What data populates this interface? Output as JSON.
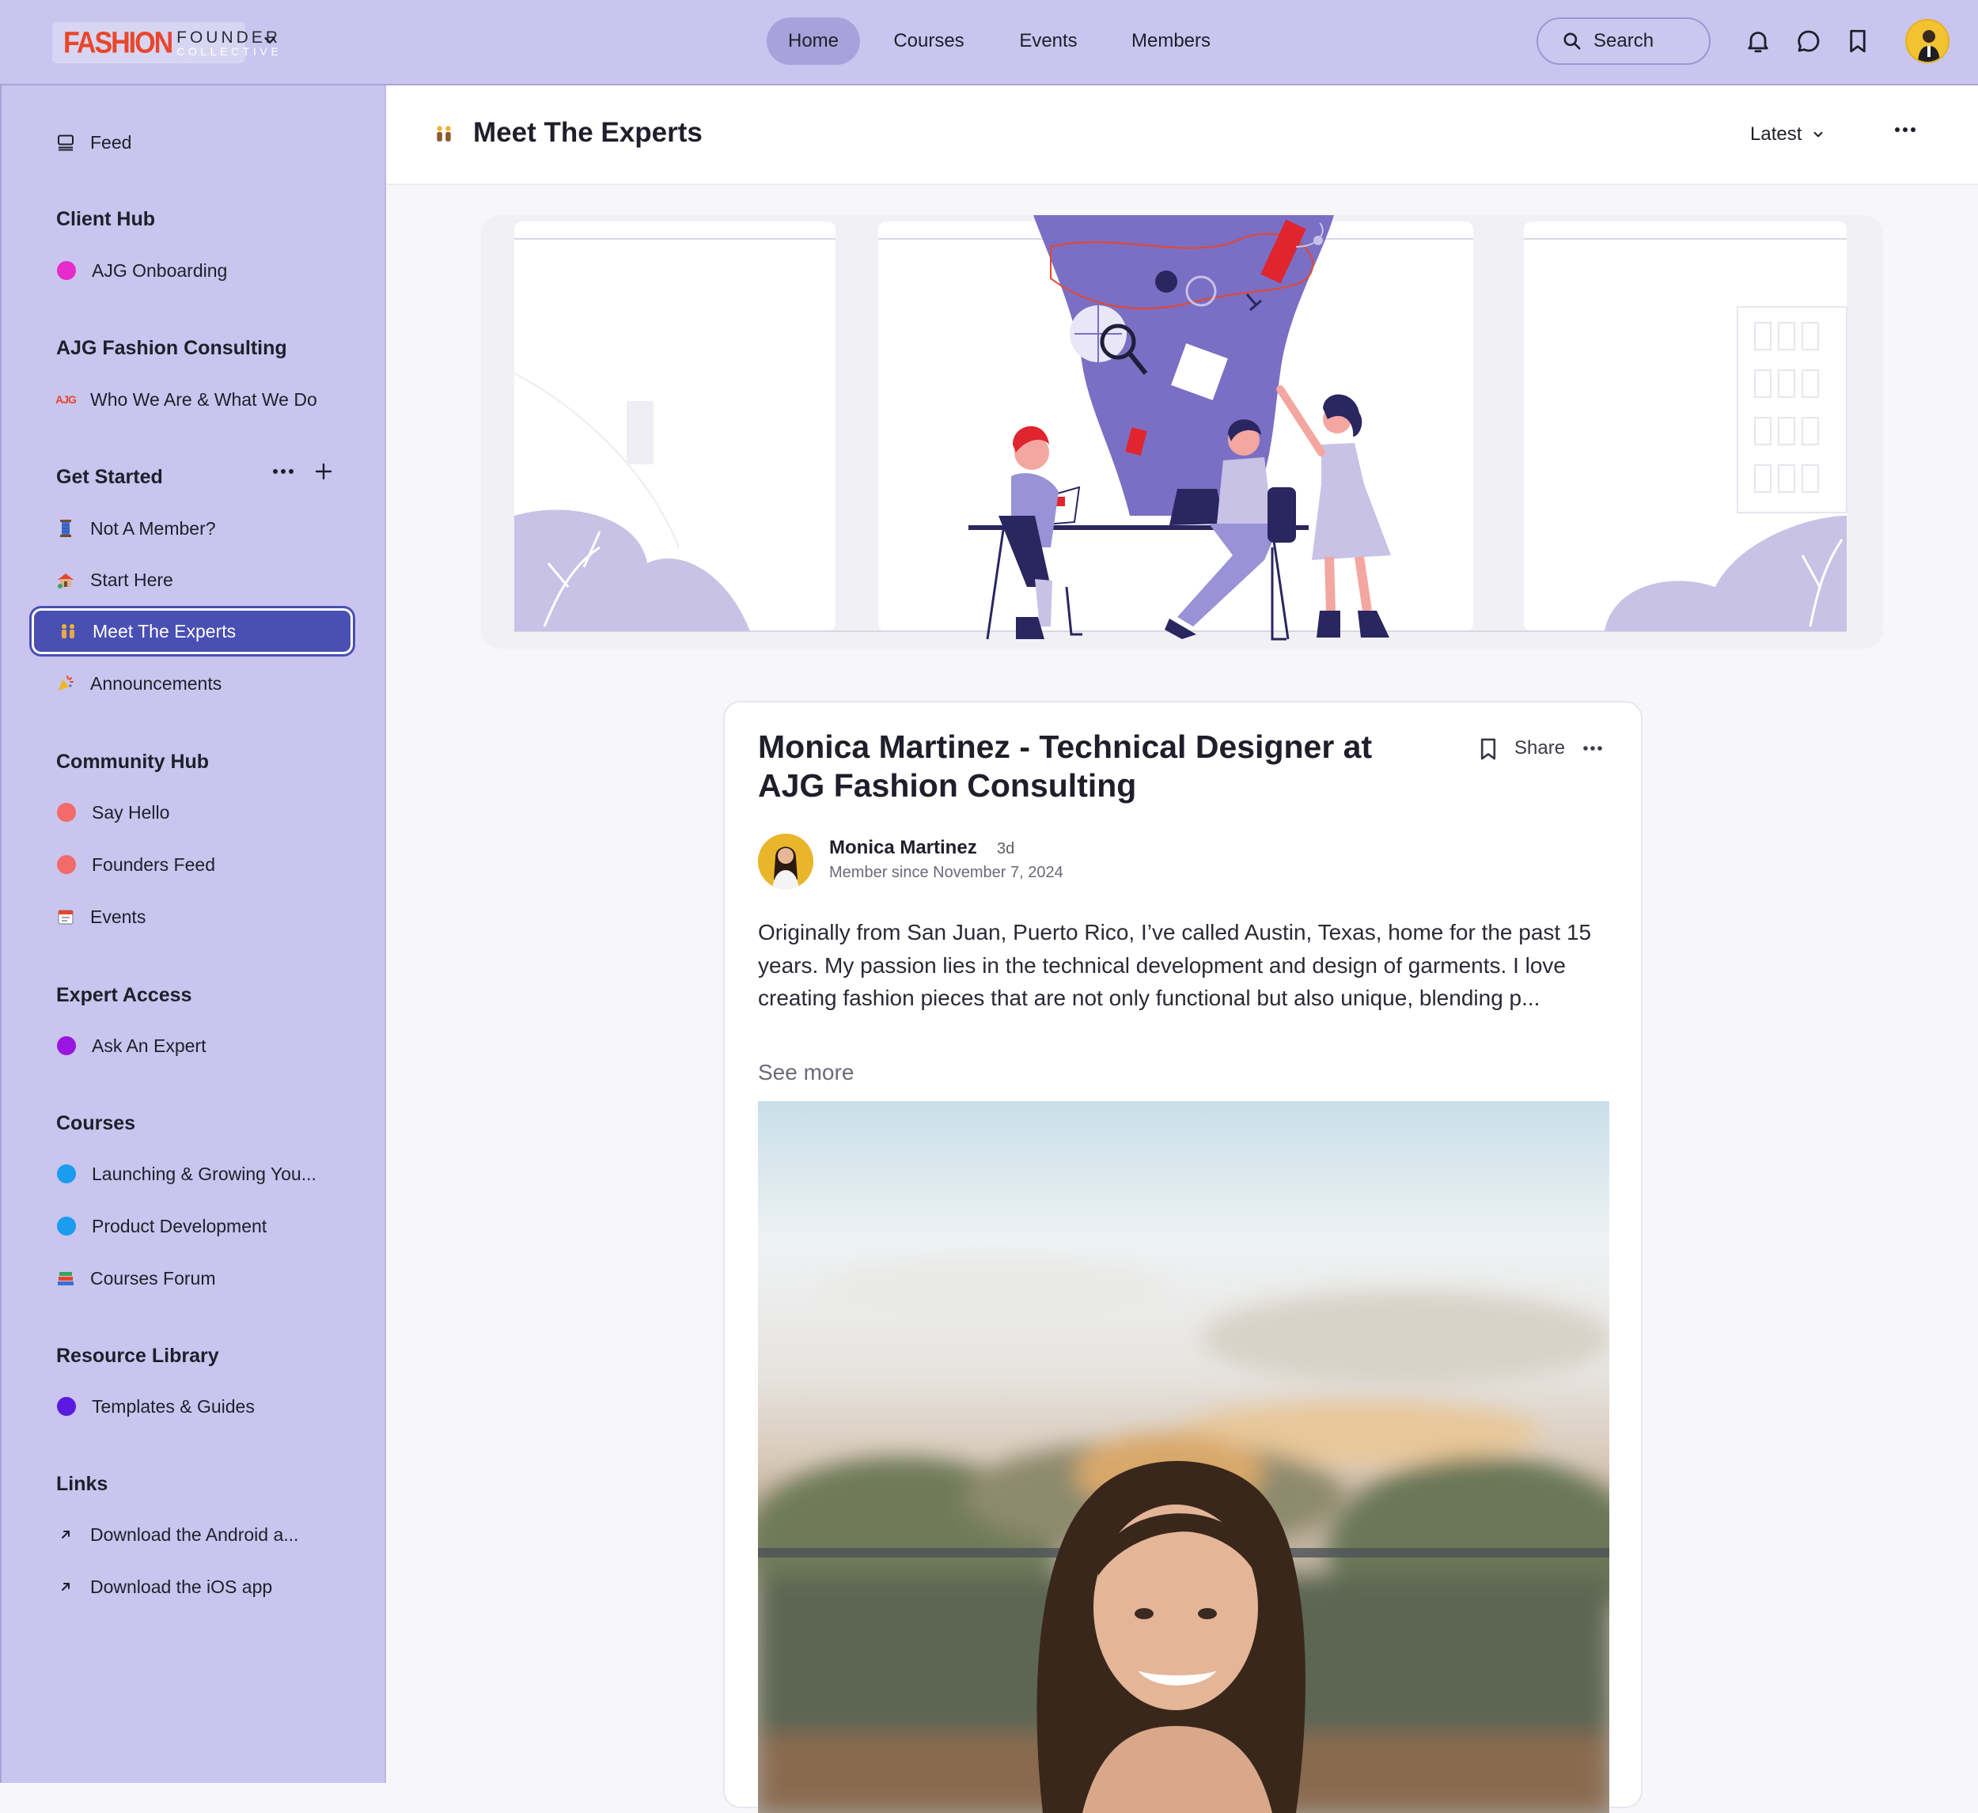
{
  "brand": {
    "logo_word": "FASHION",
    "logo_founder": "FOUNDER",
    "logo_collective": "COLLECTIVE"
  },
  "nav": {
    "home": "Home",
    "courses": "Courses",
    "events": "Events",
    "members": "Members",
    "search": "Search"
  },
  "icons": [
    "chevron-down-icon",
    "search-icon",
    "bell-icon",
    "chat-icon",
    "bookmark-icon",
    "feed-icon",
    "ellipsis-icon",
    "plus-icon",
    "external-link-icon"
  ],
  "colors": {
    "topbar": "#c9c5ee",
    "active": "#4a4fb3",
    "accent_red": "#e8462c"
  },
  "sidebar": {
    "feed": "Feed",
    "client_hub": {
      "heading": "Client Hub",
      "items": [
        "AJG Onboarding"
      ]
    },
    "ajg": {
      "heading": "AJG Fashion Consulting",
      "items": [
        "Who We Are & What We Do"
      ]
    },
    "get_started": {
      "heading": "Get Started",
      "items": [
        "Not A Member?",
        "Start Here",
        "Meet The Experts",
        "Announcements"
      ]
    },
    "community": {
      "heading": "Community Hub",
      "items": [
        "Say Hello",
        "Founders Feed",
        "Events"
      ]
    },
    "expert": {
      "heading": "Expert Access",
      "items": [
        "Ask An Expert"
      ]
    },
    "courses": {
      "heading": "Courses",
      "items": [
        "Launching & Growing You...",
        "Product Development",
        "Courses Forum"
      ]
    },
    "resources": {
      "heading": "Resource Library",
      "items": [
        "Templates & Guides"
      ]
    },
    "links": {
      "heading": "Links",
      "items": [
        "Download the Android a...",
        "Download the iOS app"
      ]
    }
  },
  "header": {
    "title": "Meet The Experts",
    "sort": "Latest"
  },
  "post": {
    "title": "Monica Martinez - Technical Designer at AJG Fashion Consulting",
    "share": "Share",
    "author": "Monica Martinez",
    "time": "3d",
    "member_since": "Member since November 7, 2024",
    "body": "Originally from San Juan, Puerto Rico, I’ve called Austin, Texas, home for the past 15 years. My passion lies in the technical development and design of garments. I love creating fashion pieces that are not only functional but also unique, blending p...",
    "see_more": "See more"
  }
}
